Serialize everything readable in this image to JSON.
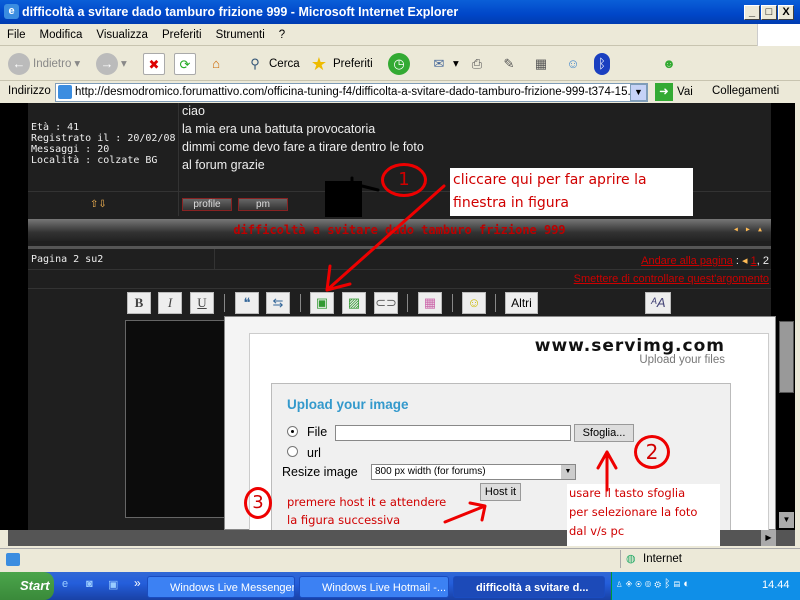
{
  "window": {
    "title": "difficoltà a svitare dado tamburo frizione 999 - Microsoft Internet Explorer",
    "min": "_",
    "max": "□",
    "close": "X"
  },
  "menu": [
    "File",
    "Modifica",
    "Visualizza",
    "Preferiti",
    "Strumenti",
    "?"
  ],
  "toolbar": {
    "back": "Indietro",
    "search": "Cerca",
    "favorites": "Preferiti"
  },
  "address": {
    "label": "Indirizzo",
    "url": "http://desmodromico.forumattivo.com/officina-tuning-f4/difficolta-a-svitare-dado-tamburo-frizione-999-t374-15.htm",
    "go": "Vai",
    "links": "Collegamenti"
  },
  "profile": {
    "age": "Età : 41",
    "registered": "Registrato il : 20/02/08",
    "messages": "Messaggi : 20",
    "location": "Località : colzate BG"
  },
  "post": {
    "lines": [
      "ciao",
      "la mia era una battuta provocatoria",
      "dimmi come devo fare a tirare dentro le foto",
      "al forum grazie"
    ],
    "profile_btn": "profile",
    "pm_btn": "pm"
  },
  "topic": {
    "title": "difficoltà a svitare dado tamburo frizione 999",
    "page_info": "Pagina 2 su2",
    "goto_label": "Andare alla pagina",
    "sep": ":",
    "page1": "1",
    "page2": ", 2",
    "unwatch": "Smettere di controllare quest'argomento"
  },
  "editor": {
    "bold": "B",
    "italic": "I",
    "underline": "U",
    "more": "Altri"
  },
  "upload": {
    "logo": "www.servimg.com",
    "tagline": "Upload your files",
    "heading": "Upload your image",
    "file_label": "File",
    "file_value": "",
    "browse": "Sfoglia...",
    "url_label": "url",
    "resize_label": "Resize image",
    "resize_value": "800 px width (for forums)",
    "host": "Host it"
  },
  "annotations": {
    "n1": "1",
    "note1": [
      "cliccare qui per far aprire la",
      "finestra in figura"
    ],
    "n2": "2",
    "note2": [
      "usare il tasto sfoglia",
      "per selezionare la foto",
      "dal v/s pc"
    ],
    "n3": "3",
    "note3": [
      "premere host it e attendere",
      "la figura successiva"
    ],
    "color": "#e00000"
  },
  "status": {
    "zone": "Internet"
  },
  "taskbar": {
    "start": "Start",
    "tasks": [
      "Windows Live Messenger",
      "Windows Live Hotmail -...",
      "difficoltà a svitare d..."
    ],
    "clock": "14.44"
  }
}
